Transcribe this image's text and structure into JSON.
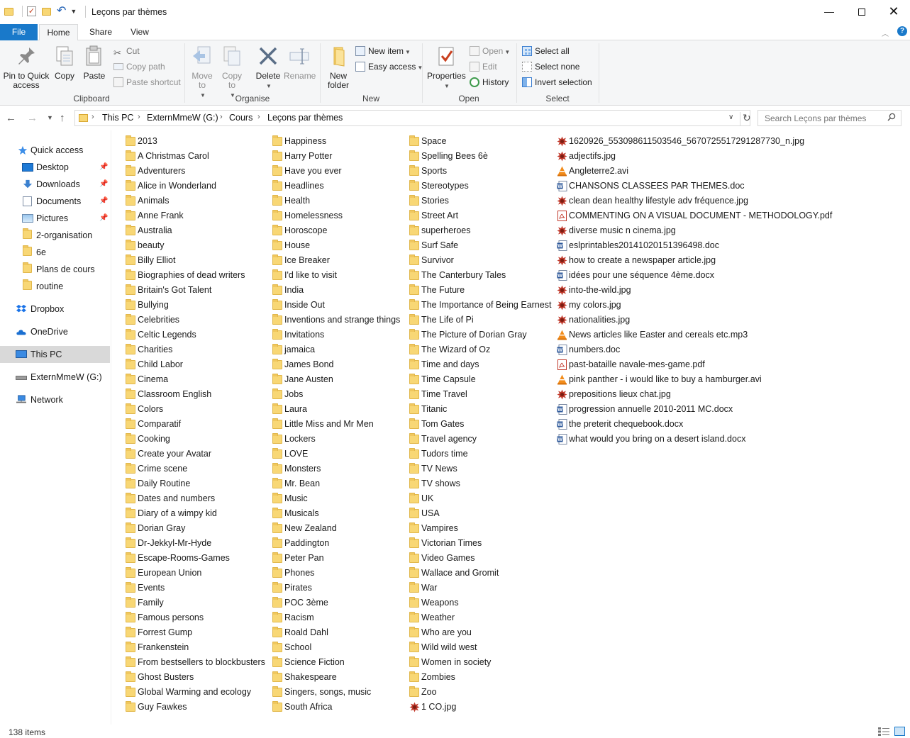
{
  "window": {
    "title": "Leçons par thèmes",
    "minimize_glyph": "—",
    "close_glyph": "✕"
  },
  "ribbon_tabs": {
    "file": "File",
    "home": "Home",
    "share": "Share",
    "view": "View"
  },
  "ribbon": {
    "clipboard": {
      "label": "Clipboard",
      "pin_quick_access": "Pin to Quick access",
      "copy": "Copy",
      "paste": "Paste",
      "cut": "Cut",
      "copy_path": "Copy path",
      "paste_shortcut": "Paste shortcut"
    },
    "organise": {
      "label": "Organise",
      "move_to": "Move to",
      "copy_to": "Copy to",
      "delete": "Delete",
      "rename": "Rename"
    },
    "new": {
      "label": "New",
      "new_folder": "New folder",
      "new_item": "New item",
      "easy_access": "Easy access"
    },
    "open": {
      "label": "Open",
      "properties": "Properties",
      "open": "Open",
      "edit": "Edit",
      "history": "History"
    },
    "select": {
      "label": "Select",
      "select_all": "Select all",
      "select_none": "Select none",
      "invert_selection": "Invert selection"
    }
  },
  "address": {
    "crumbs": [
      "This PC",
      "ExternMmeW (G:)",
      "Cours",
      "Leçons par thèmes"
    ],
    "separator": "›"
  },
  "search": {
    "placeholder": "Search Leçons par thèmes"
  },
  "nav_pane": {
    "quick_access": "Quick access",
    "pinned": [
      "Desktop",
      "Downloads",
      "Documents",
      "Pictures"
    ],
    "recent": [
      "2-organisation",
      "6e",
      "Plans de cours",
      "routine"
    ],
    "dropbox": "Dropbox",
    "onedrive": "OneDrive",
    "this_pc": "This PC",
    "drive": "ExternMmeW (G:)",
    "network": "Network"
  },
  "files": {
    "col1": [
      "2013",
      "A Christmas Carol",
      "Adventurers",
      "Alice in Wonderland",
      "Animals",
      "Anne Frank",
      "Australia",
      "beauty",
      "Billy Elliot",
      "Biographies of dead writers",
      "Britain's Got Talent",
      "Bullying",
      "Celebrities",
      "Celtic Legends",
      "Charities",
      "Child Labor",
      "Cinema",
      "Classroom English",
      "Colors",
      "Comparatif",
      "Cooking",
      "Create your Avatar",
      "Crime scene",
      "Daily Routine",
      "Dates and numbers",
      "Diary of a wimpy kid",
      "Dorian Gray",
      "Dr-Jekkyl-Mr-Hyde",
      "Escape-Rooms-Games",
      "European Union",
      "Events",
      "Family",
      "Famous persons",
      "Forrest Gump",
      "Frankenstein",
      "From bestsellers to blockbusters",
      "Ghost Busters",
      "Global Warming and ecology",
      "Guy Fawkes"
    ],
    "col2": [
      "Happiness",
      "Harry Potter",
      "Have you ever",
      "Headlines",
      "Health",
      "Homelessness",
      "Horoscope",
      "House",
      "Ice Breaker",
      "I'd like to visit",
      "India",
      "Inside Out",
      "Inventions and strange things",
      "Invitations",
      "jamaica",
      "James Bond",
      "Jane Austen",
      "Jobs",
      "Laura",
      "Little Miss and Mr Men",
      "Lockers",
      "LOVE",
      "Monsters",
      "Mr. Bean",
      "Music",
      "Musicals",
      "New Zealand",
      "Paddington",
      "Peter Pan",
      "Phones",
      "Pirates",
      "POC 3ème",
      "Racism",
      "Roald Dahl",
      "School",
      "Science Fiction",
      "Shakespeare",
      "Singers, songs, music",
      "South Africa"
    ],
    "col3": [
      {
        "name": "Space",
        "type": "folder"
      },
      {
        "name": "Spelling Bees 6è",
        "type": "folder"
      },
      {
        "name": "Sports",
        "type": "folder"
      },
      {
        "name": "Stereotypes",
        "type": "folder"
      },
      {
        "name": "Stories",
        "type": "folder"
      },
      {
        "name": "Street Art",
        "type": "folder"
      },
      {
        "name": "superheroes",
        "type": "folder"
      },
      {
        "name": "Surf Safe",
        "type": "folder"
      },
      {
        "name": "Survivor",
        "type": "folder"
      },
      {
        "name": "The Canterbury Tales",
        "type": "folder"
      },
      {
        "name": "The Future",
        "type": "folder"
      },
      {
        "name": "The Importance of Being Earnest",
        "type": "folder"
      },
      {
        "name": "The Life of Pi",
        "type": "folder"
      },
      {
        "name": "The Picture of Dorian Gray",
        "type": "folder"
      },
      {
        "name": "The Wizard of Oz",
        "type": "folder"
      },
      {
        "name": "Time and days",
        "type": "folder"
      },
      {
        "name": "Time Capsule",
        "type": "folder"
      },
      {
        "name": "Time Travel",
        "type": "folder"
      },
      {
        "name": "Titanic",
        "type": "folder"
      },
      {
        "name": "Tom Gates",
        "type": "folder"
      },
      {
        "name": "Travel agency",
        "type": "folder"
      },
      {
        "name": "Tudors time",
        "type": "folder"
      },
      {
        "name": "TV News",
        "type": "folder"
      },
      {
        "name": "TV shows",
        "type": "folder"
      },
      {
        "name": "UK",
        "type": "folder"
      },
      {
        "name": "USA",
        "type": "folder"
      },
      {
        "name": "Vampires",
        "type": "folder"
      },
      {
        "name": "Victorian Times",
        "type": "folder"
      },
      {
        "name": "Video Games",
        "type": "folder"
      },
      {
        "name": "Wallace and Gromit",
        "type": "folder"
      },
      {
        "name": "War",
        "type": "folder"
      },
      {
        "name": "Weapons",
        "type": "folder"
      },
      {
        "name": "Weather",
        "type": "folder"
      },
      {
        "name": "Who are you",
        "type": "folder"
      },
      {
        "name": "Wild wild west",
        "type": "folder"
      },
      {
        "name": "Women in society",
        "type": "folder"
      },
      {
        "name": "Zombies",
        "type": "folder"
      },
      {
        "name": "Zoo",
        "type": "folder"
      },
      {
        "name": "1 CO.jpg",
        "type": "image"
      }
    ],
    "col4": [
      {
        "name": "1620926_553098611503546_5670725517291287730_n.jpg",
        "type": "image"
      },
      {
        "name": "adjectifs.jpg",
        "type": "image"
      },
      {
        "name": "Angleterre2.avi",
        "type": "video"
      },
      {
        "name": "CHANSONS CLASSEES PAR THEMES.doc",
        "type": "word"
      },
      {
        "name": "clean dean healthy lifestyle adv fréquence.jpg",
        "type": "image"
      },
      {
        "name": "COMMENTING ON A VISUAL DOCUMENT - METHODOLOGY.pdf",
        "type": "pdf"
      },
      {
        "name": "diverse music n cinema.jpg",
        "type": "image"
      },
      {
        "name": "eslprintables2014102015139649‍8.doc",
        "type": "word"
      },
      {
        "name": "how to create a newspaper article.jpg",
        "type": "image"
      },
      {
        "name": "idées pour une séquence 4ème.docx",
        "type": "word"
      },
      {
        "name": "into-the-wild.jpg",
        "type": "image"
      },
      {
        "name": "my colors.jpg",
        "type": "image"
      },
      {
        "name": "nationalities.jpg",
        "type": "image"
      },
      {
        "name": "News articles like Easter and cereals etc.mp3",
        "type": "video"
      },
      {
        "name": "numbers.doc",
        "type": "word"
      },
      {
        "name": "past-bataille navale-mes-game.pdf",
        "type": "pdf"
      },
      {
        "name": "pink panther - i would like to buy a hamburger.avi",
        "type": "video"
      },
      {
        "name": "prepositions lieux chat.jpg",
        "type": "image"
      },
      {
        "name": "progression annuelle 2010-2011 MC.docx",
        "type": "word"
      },
      {
        "name": "the preterit chequebook.docx",
        "type": "word"
      },
      {
        "name": "what would you bring on a desert island.docx",
        "type": "word"
      }
    ]
  },
  "status": {
    "item_count": "138 items"
  },
  "colors": {
    "accent": "#1979ca",
    "folder": "#f8d775",
    "selected_nav": "#d9d9d9"
  }
}
